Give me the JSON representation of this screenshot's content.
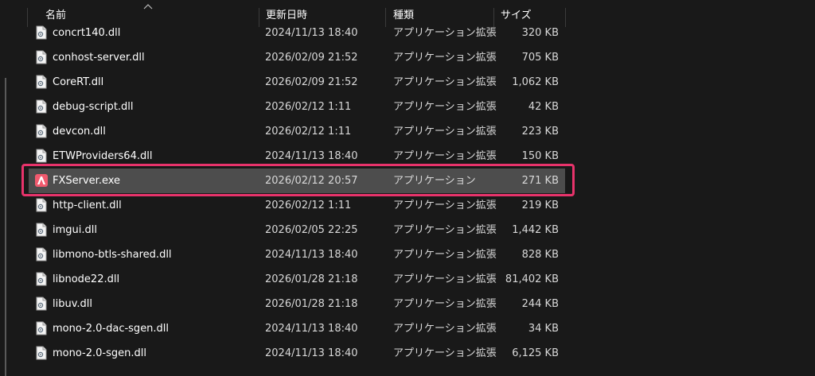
{
  "columns": {
    "name": "名前",
    "date": "更新日時",
    "type": "種類",
    "size": "サイズ"
  },
  "files": [
    {
      "name": "concrt140.dll",
      "date": "2024/11/13 18:40",
      "type": "アプリケーション拡張",
      "size": "320 KB",
      "icon": "dll-file-icon"
    },
    {
      "name": "conhost-server.dll",
      "date": "2026/02/09 21:52",
      "type": "アプリケーション拡張",
      "size": "705 KB",
      "icon": "dll-file-icon"
    },
    {
      "name": "CoreRT.dll",
      "date": "2026/02/09 21:52",
      "type": "アプリケーション拡張",
      "size": "1,062 KB",
      "icon": "dll-file-icon"
    },
    {
      "name": "debug-script.dll",
      "date": "2026/02/12 1:11",
      "type": "アプリケーション拡張",
      "size": "42 KB",
      "icon": "dll-file-icon"
    },
    {
      "name": "devcon.dll",
      "date": "2026/02/12 1:11",
      "type": "アプリケーション拡張",
      "size": "223 KB",
      "icon": "dll-file-icon"
    },
    {
      "name": "ETWProviders64.dll",
      "date": "2024/11/13 18:40",
      "type": "アプリケーション拡張",
      "size": "150 KB",
      "icon": "dll-file-icon"
    },
    {
      "name": "FXServer.exe",
      "date": "2026/02/12 20:57",
      "type": "アプリケーション",
      "size": "271 KB",
      "icon": "fxserver-app-icon",
      "selected": true
    },
    {
      "name": "http-client.dll",
      "date": "2026/02/12 1:11",
      "type": "アプリケーション拡張",
      "size": "219 KB",
      "icon": "dll-file-icon"
    },
    {
      "name": "imgui.dll",
      "date": "2026/02/05 22:25",
      "type": "アプリケーション拡張",
      "size": "1,442 KB",
      "icon": "dll-file-icon"
    },
    {
      "name": "libmono-btls-shared.dll",
      "date": "2024/11/13 18:40",
      "type": "アプリケーション拡張",
      "size": "828 KB",
      "icon": "dll-file-icon"
    },
    {
      "name": "libnode22.dll",
      "date": "2026/01/28 21:18",
      "type": "アプリケーション拡張",
      "size": "81,402 KB",
      "icon": "dll-file-icon"
    },
    {
      "name": "libuv.dll",
      "date": "2026/01/28 21:18",
      "type": "アプリケーション拡張",
      "size": "244 KB",
      "icon": "dll-file-icon"
    },
    {
      "name": "mono-2.0-dac-sgen.dll",
      "date": "2024/11/13 18:40",
      "type": "アプリケーション拡張",
      "size": "34 KB",
      "icon": "dll-file-icon"
    },
    {
      "name": "mono-2.0-sgen.dll",
      "date": "2024/11/13 18:40",
      "type": "アプリケーション拡張",
      "size": "6,125 KB",
      "icon": "dll-file-icon"
    }
  ],
  "colors": {
    "background": "#191919",
    "selected_row": "#4d4d4d",
    "highlight_border": "#e8336b",
    "text": "#ffffff",
    "subtext": "#d8d8d8"
  }
}
